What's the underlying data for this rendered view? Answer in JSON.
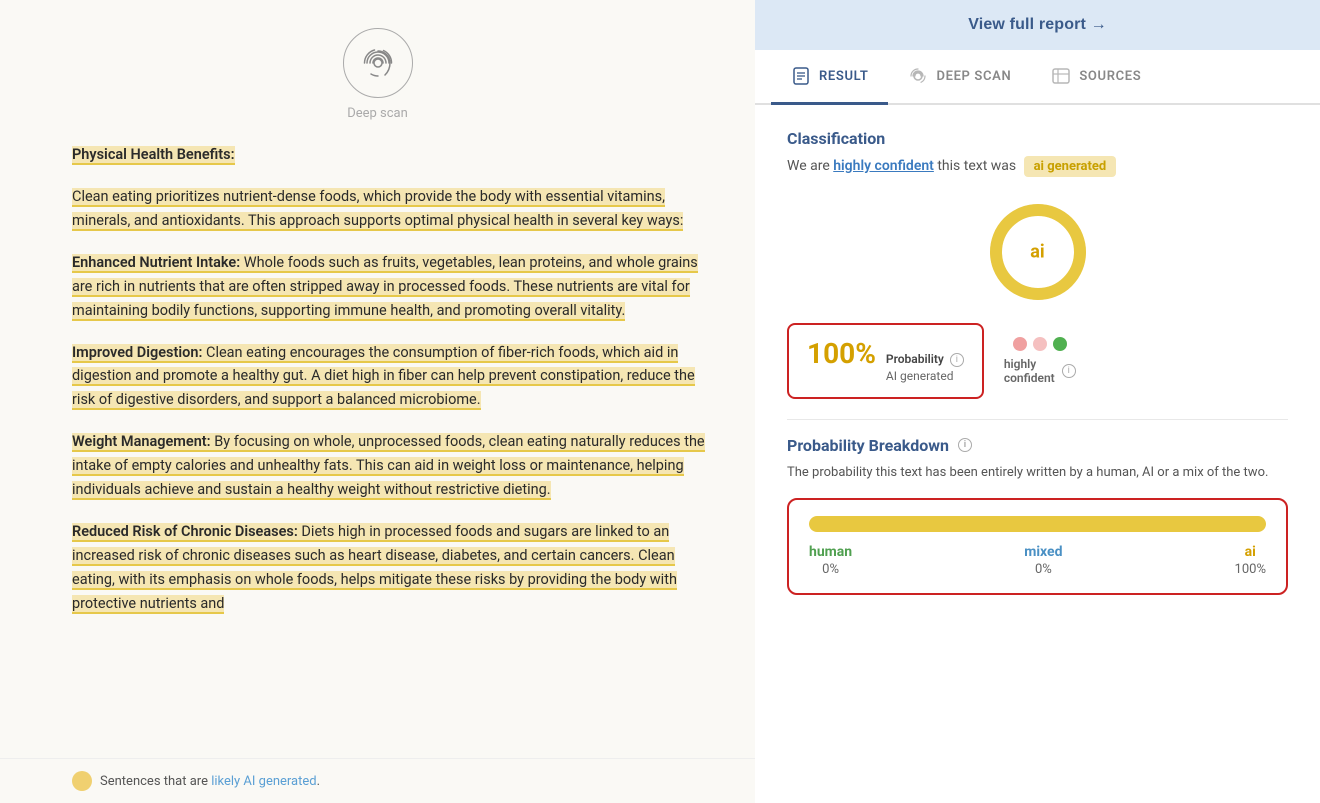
{
  "left": {
    "deep_scan_label": "Deep scan",
    "paragraphs": [
      {
        "id": "physical-health",
        "title": "Physical Health Benefits:",
        "title_highlighted": true,
        "content": "",
        "full": "Physical Health Benefits:"
      },
      {
        "id": "intro",
        "content": "Clean eating prioritizes nutrient-dense foods, which provide the body with essential vitamins, minerals, and antioxidants. This approach supports optimal physical health in several key ways:",
        "highlighted": true
      },
      {
        "id": "enhanced",
        "title": "Enhanced Nutrient Intake:",
        "title_highlighted": true,
        "content": " Whole foods such as fruits, vegetables, lean proteins, and whole grains are rich in nutrients that are often stripped away in processed foods. These nutrients are vital for maintaining bodily functions, supporting immune health, and promoting overall vitality.",
        "content_highlighted": true
      },
      {
        "id": "digestion",
        "title": "Improved Digestion:",
        "title_highlighted": true,
        "content": " Clean eating encourages the consumption of fiber-rich foods, which aid in digestion and promote a healthy gut. A diet high in fiber can help prevent constipation, reduce the risk of digestive disorders, and support a balanced microbiome.",
        "content_highlighted_partial": true
      },
      {
        "id": "weight",
        "title": "Weight Management:",
        "title_highlighted": true,
        "content": " By focusing on whole, unprocessed foods, clean eating naturally reduces the intake of empty calories and unhealthy fats. This can aid in weight loss or maintenance, helping individuals achieve and sustain a healthy weight without restrictive dieting.",
        "content_highlighted": true
      },
      {
        "id": "chronic",
        "title": "Reduced Risk of Chronic Diseases:",
        "title_highlighted": true,
        "content": " Diets high in processed foods and sugars are linked to an increased risk of chronic diseases such as heart disease, diabetes, and certain cancers. Clean eating, with its emphasis on whole foods, helps mitigate these risks by providing the body with protective nutrients and",
        "content_highlighted_partial": true
      }
    ],
    "legend_text_prefix": "Sentences that are ",
    "legend_link_text": "likely AI generated",
    "legend_text_suffix": "."
  },
  "right": {
    "view_full_report": "View full report →",
    "tabs": [
      {
        "id": "result",
        "label": "RESULT",
        "active": true
      },
      {
        "id": "deep-scan",
        "label": "DEEP SCAN",
        "active": false
      },
      {
        "id": "sources",
        "label": "SOURCES",
        "active": false
      }
    ],
    "classification": {
      "heading": "Classification",
      "desc_prefix": "We are ",
      "highly_confident": "highly confident",
      "desc_middle": " this text was",
      "badge": "ai generated"
    },
    "donut": {
      "label": "ai",
      "percentage": 100,
      "track_color": "#f5e6b3",
      "fill_color": "#e8c840"
    },
    "probability_box": {
      "percent": "100%",
      "title": "Probability",
      "subtitle": "AI generated"
    },
    "confidence": {
      "label": "highly\nconfident"
    },
    "probability_breakdown": {
      "heading": "Probability Breakdown",
      "desc": "The probability this text has been entirely written by a human, AI or a mix of the two.",
      "bars": [
        {
          "label": "human",
          "pct": 0,
          "color": "human"
        },
        {
          "label": "mixed",
          "pct": 0,
          "color": "mixed"
        },
        {
          "label": "ai",
          "pct": 100,
          "color": "ai"
        }
      ],
      "bar_fill_pct": 100
    }
  }
}
